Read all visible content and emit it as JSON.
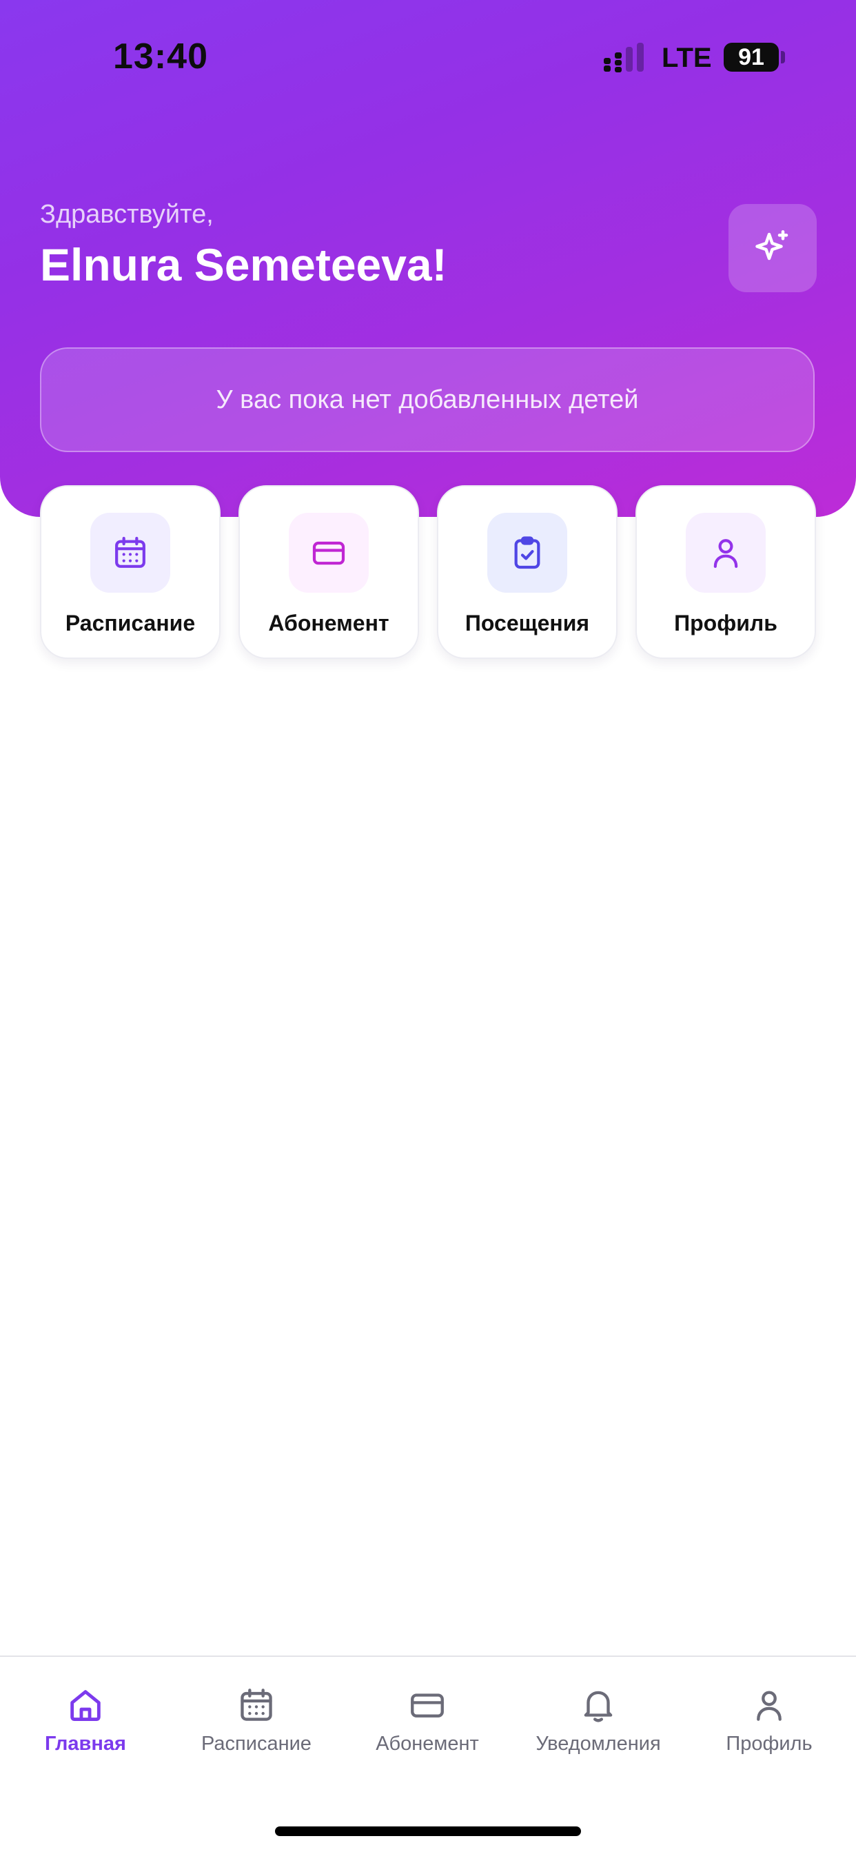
{
  "status_bar": {
    "time": "13:40",
    "network": "LTE",
    "battery": "91"
  },
  "header": {
    "greeting": "Здравствуйте,",
    "user_name": "Elnura Semeteeva!",
    "children_notice": "У вас пока нет добавленных детей"
  },
  "quick_actions": [
    {
      "label": "Расписание",
      "icon": "calendar-icon",
      "icon_color": "#7c3aed",
      "tile_bg": "#f1eeff"
    },
    {
      "label": "Абонемент",
      "icon": "credit-card-icon",
      "icon_color": "#c026d3",
      "tile_bg": "#fdf0ff"
    },
    {
      "label": "Посещения",
      "icon": "clipboard-check-icon",
      "icon_color": "#4f46e5",
      "tile_bg": "#eaedfe"
    },
    {
      "label": "Профиль",
      "icon": "user-icon",
      "icon_color": "#9333ea",
      "tile_bg": "#f7efff"
    }
  ],
  "tab_bar": {
    "active": "Главная",
    "active_color": "#7c3aed",
    "inactive_color": "#6b6b78",
    "items": [
      {
        "label": "Главная",
        "icon": "home-icon"
      },
      {
        "label": "Расписание",
        "icon": "calendar-icon"
      },
      {
        "label": "Абонемент",
        "icon": "credit-card-icon"
      },
      {
        "label": "Уведомления",
        "icon": "bell-icon"
      },
      {
        "label": "Профиль",
        "icon": "user-icon"
      }
    ]
  }
}
